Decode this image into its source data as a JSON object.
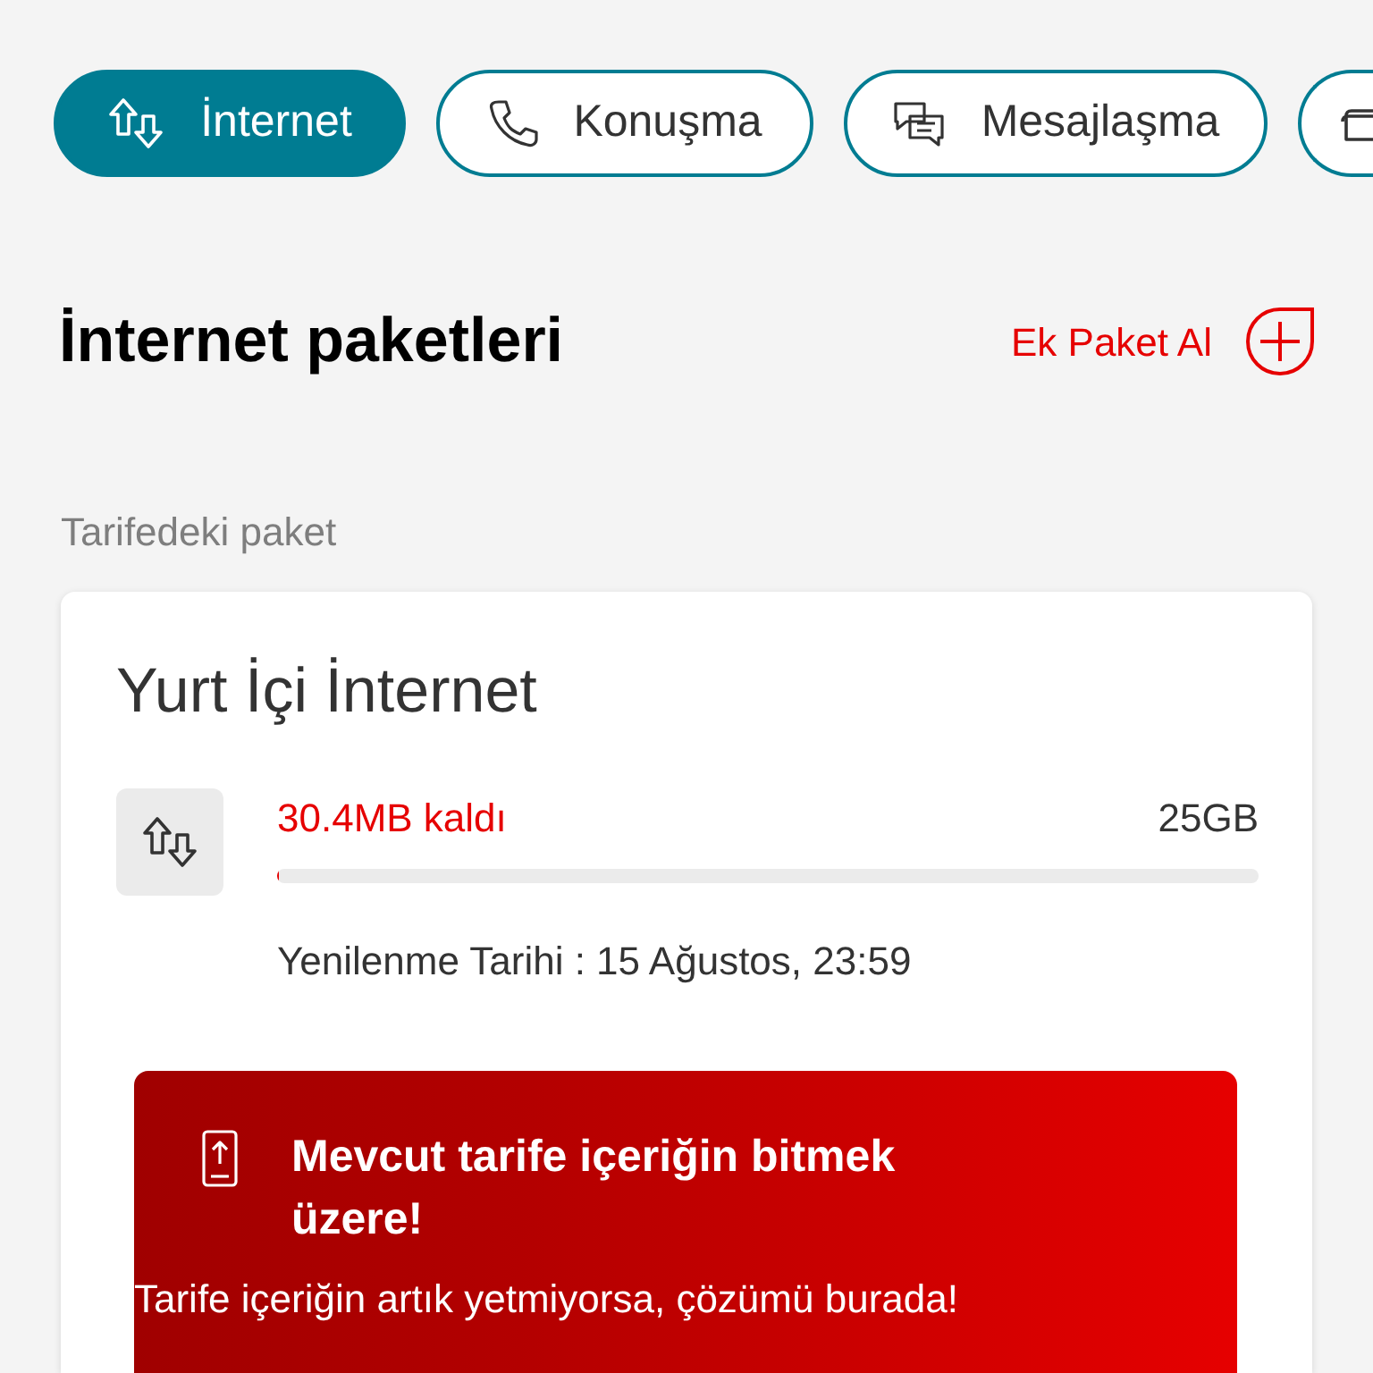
{
  "tabs": [
    {
      "label": "İnternet",
      "selected": true,
      "kind": "internet"
    },
    {
      "label": "Konuşma",
      "selected": false,
      "kind": "call"
    },
    {
      "label": "Mesajlaşma",
      "selected": false,
      "kind": "message"
    },
    {
      "selected": false,
      "kind": "card"
    }
  ],
  "header": {
    "title": "İnternet paketleri",
    "action": "Ek Paket Al"
  },
  "section_label": "Tarifedeki paket",
  "package": {
    "title": "Yurt İçi İnternet",
    "remaining": "30.4MB kaldı",
    "total": "25GB",
    "level": 0.002,
    "renewal": "Yenilenme Tarihi : 15 Ağustos, 23:59"
  },
  "alert": {
    "title": "Mevcut tarife içeriğin bitmek üzere!",
    "message": "Tarife içeriğin artık yetmiyorsa, çözümü burada!"
  }
}
